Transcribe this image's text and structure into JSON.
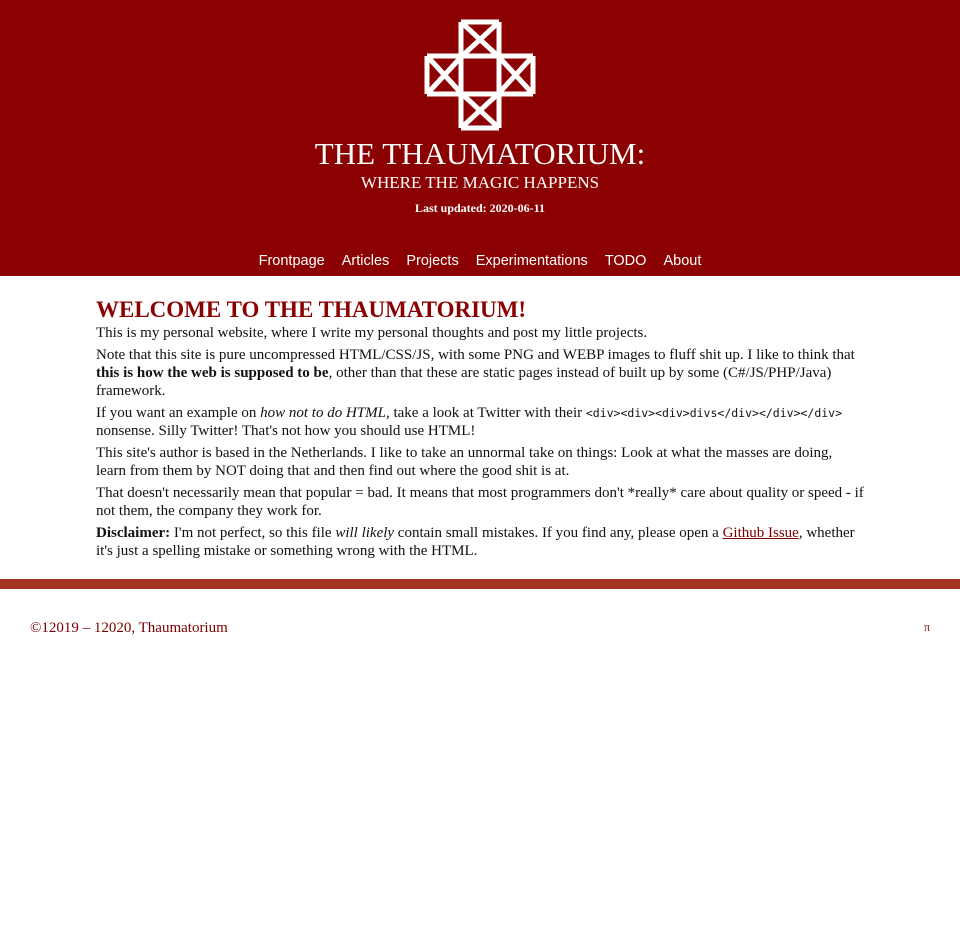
{
  "header": {
    "title": "THE THAUMATORIUM:",
    "subtitle": "WHERE THE MAGIC HAPPENS",
    "last_updated": "Last updated: 2020-06-11"
  },
  "nav": {
    "items": [
      "Frontpage",
      "Articles",
      "Projects",
      "Experimentations",
      "TODO",
      "About"
    ]
  },
  "main": {
    "heading": "WELCOME TO THE THAUMATORIUM!",
    "p1": "This is my personal website, where I write my personal thoughts and post my little projects.",
    "p2": {
      "a": "Note that this site is pure uncompressed HTML/CSS/JS, with some PNG and WEBP images to fluff shit up. I like to think that ",
      "b": "this is how the web is supposed to be",
      "c": ", other than that these are static pages instead of built up by some (C#/JS/PHP/Java) framework."
    },
    "p3": {
      "a": "If you want an example on ",
      "b": "how not to do HTML",
      "c": ", take a look at Twitter with their ",
      "code": "<div><div><div>divs</div></div></div>",
      "d": " nonsense. Silly Twitter! That's not how you should use HTML!"
    },
    "p4": "This site's author is based in the Netherlands. I like to take an unnormal take on things: Look at what the masses are doing, learn from them by NOT doing that and then find out where the good shit is at.",
    "p5": "That doesn't necessarily mean that popular = bad. It means that most programmers don't *really* care about quality or speed - if not them, the company they work for.",
    "p6": {
      "label": "Disclaimer:",
      "a": " I'm not perfect, so this file ",
      "b": "will likely",
      "c": " contain small mistakes. If you find any, please open a ",
      "link": "Github Issue",
      "d": ", whether it's just a spelling mistake or something wrong with the HTML."
    }
  },
  "footer": {
    "copyright": "©12019 – 12020, Thaumatorium",
    "pi": "π"
  },
  "colors": {
    "header_bg": "#8b0000",
    "heading": "#8b0000",
    "divider": "#a33424",
    "footer_text": "#7a0000"
  },
  "icons": {
    "logo": "star-octagram-logo-icon"
  }
}
